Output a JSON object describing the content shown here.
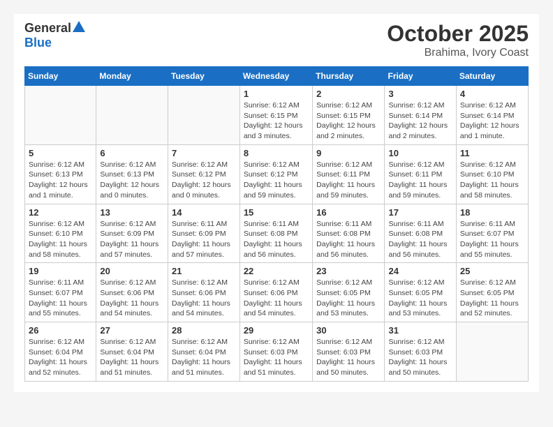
{
  "header": {
    "logo_general": "General",
    "logo_blue": "Blue",
    "month": "October 2025",
    "location": "Brahima, Ivory Coast"
  },
  "weekdays": [
    "Sunday",
    "Monday",
    "Tuesday",
    "Wednesday",
    "Thursday",
    "Friday",
    "Saturday"
  ],
  "weeks": [
    [
      {
        "day": "",
        "info": ""
      },
      {
        "day": "",
        "info": ""
      },
      {
        "day": "",
        "info": ""
      },
      {
        "day": "1",
        "info": "Sunrise: 6:12 AM\nSunset: 6:15 PM\nDaylight: 12 hours\nand 3 minutes."
      },
      {
        "day": "2",
        "info": "Sunrise: 6:12 AM\nSunset: 6:15 PM\nDaylight: 12 hours\nand 2 minutes."
      },
      {
        "day": "3",
        "info": "Sunrise: 6:12 AM\nSunset: 6:14 PM\nDaylight: 12 hours\nand 2 minutes."
      },
      {
        "day": "4",
        "info": "Sunrise: 6:12 AM\nSunset: 6:14 PM\nDaylight: 12 hours\nand 1 minute."
      }
    ],
    [
      {
        "day": "5",
        "info": "Sunrise: 6:12 AM\nSunset: 6:13 PM\nDaylight: 12 hours\nand 1 minute."
      },
      {
        "day": "6",
        "info": "Sunrise: 6:12 AM\nSunset: 6:13 PM\nDaylight: 12 hours\nand 0 minutes."
      },
      {
        "day": "7",
        "info": "Sunrise: 6:12 AM\nSunset: 6:12 PM\nDaylight: 12 hours\nand 0 minutes."
      },
      {
        "day": "8",
        "info": "Sunrise: 6:12 AM\nSunset: 6:12 PM\nDaylight: 11 hours\nand 59 minutes."
      },
      {
        "day": "9",
        "info": "Sunrise: 6:12 AM\nSunset: 6:11 PM\nDaylight: 11 hours\nand 59 minutes."
      },
      {
        "day": "10",
        "info": "Sunrise: 6:12 AM\nSunset: 6:11 PM\nDaylight: 11 hours\nand 59 minutes."
      },
      {
        "day": "11",
        "info": "Sunrise: 6:12 AM\nSunset: 6:10 PM\nDaylight: 11 hours\nand 58 minutes."
      }
    ],
    [
      {
        "day": "12",
        "info": "Sunrise: 6:12 AM\nSunset: 6:10 PM\nDaylight: 11 hours\nand 58 minutes."
      },
      {
        "day": "13",
        "info": "Sunrise: 6:12 AM\nSunset: 6:09 PM\nDaylight: 11 hours\nand 57 minutes."
      },
      {
        "day": "14",
        "info": "Sunrise: 6:11 AM\nSunset: 6:09 PM\nDaylight: 11 hours\nand 57 minutes."
      },
      {
        "day": "15",
        "info": "Sunrise: 6:11 AM\nSunset: 6:08 PM\nDaylight: 11 hours\nand 56 minutes."
      },
      {
        "day": "16",
        "info": "Sunrise: 6:11 AM\nSunset: 6:08 PM\nDaylight: 11 hours\nand 56 minutes."
      },
      {
        "day": "17",
        "info": "Sunrise: 6:11 AM\nSunset: 6:08 PM\nDaylight: 11 hours\nand 56 minutes."
      },
      {
        "day": "18",
        "info": "Sunrise: 6:11 AM\nSunset: 6:07 PM\nDaylight: 11 hours\nand 55 minutes."
      }
    ],
    [
      {
        "day": "19",
        "info": "Sunrise: 6:11 AM\nSunset: 6:07 PM\nDaylight: 11 hours\nand 55 minutes."
      },
      {
        "day": "20",
        "info": "Sunrise: 6:12 AM\nSunset: 6:06 PM\nDaylight: 11 hours\nand 54 minutes."
      },
      {
        "day": "21",
        "info": "Sunrise: 6:12 AM\nSunset: 6:06 PM\nDaylight: 11 hours\nand 54 minutes."
      },
      {
        "day": "22",
        "info": "Sunrise: 6:12 AM\nSunset: 6:06 PM\nDaylight: 11 hours\nand 54 minutes."
      },
      {
        "day": "23",
        "info": "Sunrise: 6:12 AM\nSunset: 6:05 PM\nDaylight: 11 hours\nand 53 minutes."
      },
      {
        "day": "24",
        "info": "Sunrise: 6:12 AM\nSunset: 6:05 PM\nDaylight: 11 hours\nand 53 minutes."
      },
      {
        "day": "25",
        "info": "Sunrise: 6:12 AM\nSunset: 6:05 PM\nDaylight: 11 hours\nand 52 minutes."
      }
    ],
    [
      {
        "day": "26",
        "info": "Sunrise: 6:12 AM\nSunset: 6:04 PM\nDaylight: 11 hours\nand 52 minutes."
      },
      {
        "day": "27",
        "info": "Sunrise: 6:12 AM\nSunset: 6:04 PM\nDaylight: 11 hours\nand 51 minutes."
      },
      {
        "day": "28",
        "info": "Sunrise: 6:12 AM\nSunset: 6:04 PM\nDaylight: 11 hours\nand 51 minutes."
      },
      {
        "day": "29",
        "info": "Sunrise: 6:12 AM\nSunset: 6:03 PM\nDaylight: 11 hours\nand 51 minutes."
      },
      {
        "day": "30",
        "info": "Sunrise: 6:12 AM\nSunset: 6:03 PM\nDaylight: 11 hours\nand 50 minutes."
      },
      {
        "day": "31",
        "info": "Sunrise: 6:12 AM\nSunset: 6:03 PM\nDaylight: 11 hours\nand 50 minutes."
      },
      {
        "day": "",
        "info": ""
      }
    ]
  ]
}
